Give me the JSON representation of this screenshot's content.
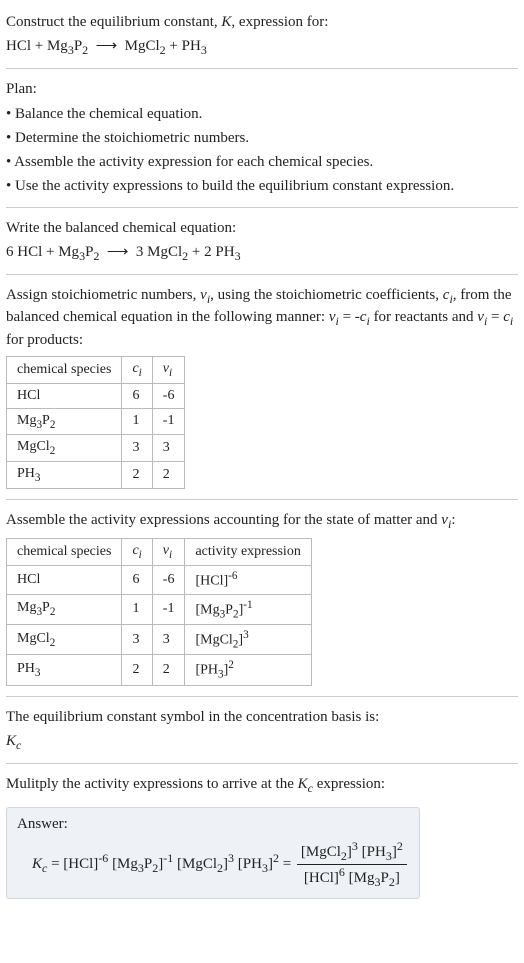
{
  "header": {
    "construct": "Construct the equilibrium constant, K, expression for:",
    "equation_unbalanced": "HCl + Mg₃P₂ ⟶ MgCl₂ + PH₃"
  },
  "plan": {
    "title": "Plan:",
    "steps": [
      "• Balance the chemical equation.",
      "• Determine the stoichiometric numbers.",
      "• Assemble the activity expression for each chemical species.",
      "• Use the activity expressions to build the equilibrium constant expression."
    ]
  },
  "balanced": {
    "intro": "Write the balanced chemical equation:",
    "equation": "6 HCl + Mg₃P₂ ⟶ 3 MgCl₂ + 2 PH₃"
  },
  "assign": {
    "text": "Assign stoichiometric numbers, νᵢ, using the stoichiometric coefficients, cᵢ, from the balanced chemical equation in the following manner: νᵢ = -cᵢ for reactants and νᵢ = cᵢ for products:",
    "table_headers": [
      "chemical species",
      "cᵢ",
      "νᵢ"
    ],
    "rows": [
      {
        "species": "HCl",
        "c": "6",
        "v": "-6"
      },
      {
        "species": "Mg₃P₂",
        "c": "1",
        "v": "-1"
      },
      {
        "species": "MgCl₂",
        "c": "3",
        "v": "3"
      },
      {
        "species": "PH₃",
        "c": "2",
        "v": "2"
      }
    ]
  },
  "activity": {
    "intro": "Assemble the activity expressions accounting for the state of matter and νᵢ:",
    "table_headers": [
      "chemical species",
      "cᵢ",
      "νᵢ",
      "activity expression"
    ],
    "rows": [
      {
        "species": "HCl",
        "c": "6",
        "v": "-6",
        "expr": "[HCl]⁻⁶"
      },
      {
        "species": "Mg₃P₂",
        "c": "1",
        "v": "-1",
        "expr": "[Mg₃P₂]⁻¹"
      },
      {
        "species": "MgCl₂",
        "c": "3",
        "v": "3",
        "expr": "[MgCl₂]³"
      },
      {
        "species": "PH₃",
        "c": "2",
        "v": "2",
        "expr": "[PH₃]²"
      }
    ]
  },
  "symbol": {
    "line1": "The equilibrium constant symbol in the concentration basis is:",
    "line2": "K𝑐"
  },
  "multiply": {
    "intro": "Mulitply the activity expressions to arrive at the K𝑐 expression:",
    "answer_label": "Answer:",
    "lhs": "K𝑐 = [HCl]⁻⁶ [Mg₃P₂]⁻¹ [MgCl₂]³ [PH₃]² =",
    "frac_num": "[MgCl₂]³ [PH₃]²",
    "frac_den": "[HCl]⁶ [Mg₃P₂]"
  }
}
